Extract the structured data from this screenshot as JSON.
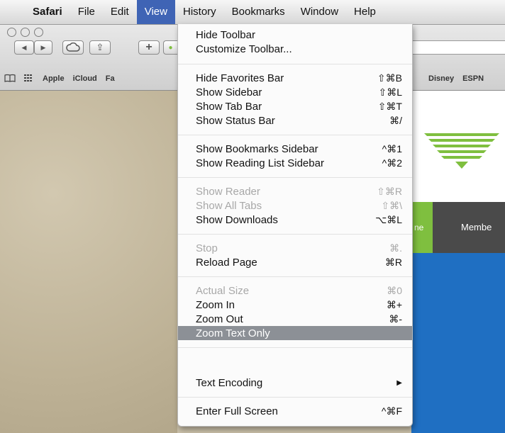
{
  "menubar": {
    "apple": "",
    "app_name": "Safari",
    "items": [
      "File",
      "Edit",
      "View",
      "History",
      "Bookmarks",
      "Window",
      "Help"
    ]
  },
  "toolbar": {
    "back_label": "◀",
    "forward_label": "▶",
    "share_label": "⇪",
    "add_label": "+"
  },
  "favorites_bar": {
    "left_items": [
      "Apple",
      "iCloud",
      "Fa"
    ],
    "right_items": [
      "Disney",
      "ESPN"
    ]
  },
  "website": {
    "nav_green_text": "ne",
    "nav_dark_text": "Membe"
  },
  "view_menu": {
    "items": [
      {
        "label": "Hide Toolbar",
        "shortcut": "",
        "state": "enabled"
      },
      {
        "label": "Customize Toolbar...",
        "shortcut": "",
        "state": "enabled"
      },
      {
        "label": "Hide Favorites Bar",
        "shortcut": "⇧⌘B",
        "state": "enabled"
      },
      {
        "label": "Show Sidebar",
        "shortcut": "⇧⌘L",
        "state": "enabled"
      },
      {
        "label": "Show Tab Bar",
        "shortcut": "⇧⌘T",
        "state": "enabled"
      },
      {
        "label": "Show Status Bar",
        "shortcut": "⌘/",
        "state": "enabled"
      },
      {
        "label": "Show Bookmarks Sidebar",
        "shortcut": "^⌘1",
        "state": "enabled"
      },
      {
        "label": "Show Reading List Sidebar",
        "shortcut": "^⌘2",
        "state": "enabled"
      },
      {
        "label": "Show Reader",
        "shortcut": "⇧⌘R",
        "state": "disabled"
      },
      {
        "label": "Show All Tabs",
        "shortcut": "⇧⌘\\",
        "state": "disabled"
      },
      {
        "label": "Show Downloads",
        "shortcut": "⌥⌘L",
        "state": "enabled"
      },
      {
        "label": "Stop",
        "shortcut": "⌘.",
        "state": "disabled"
      },
      {
        "label": "Reload Page",
        "shortcut": "⌘R",
        "state": "enabled"
      },
      {
        "label": "Actual Size",
        "shortcut": "⌘0",
        "state": "disabled"
      },
      {
        "label": "Zoom In",
        "shortcut": "⌘+",
        "state": "enabled"
      },
      {
        "label": "Zoom Out",
        "shortcut": "⌘-",
        "state": "enabled"
      },
      {
        "label": "Zoom Text Only",
        "shortcut": "",
        "state": "selected"
      },
      {
        "label": "Text Encoding",
        "shortcut": "▶",
        "state": "enabled"
      },
      {
        "label": "Enter Full Screen",
        "shortcut": "^⌘F",
        "state": "enabled"
      }
    ]
  },
  "colors": {
    "menu_highlight": "#3f64b5",
    "selected_item": "#8c9096",
    "site_green": "#7fbf3f",
    "site_blue": "#1f6fc2"
  }
}
